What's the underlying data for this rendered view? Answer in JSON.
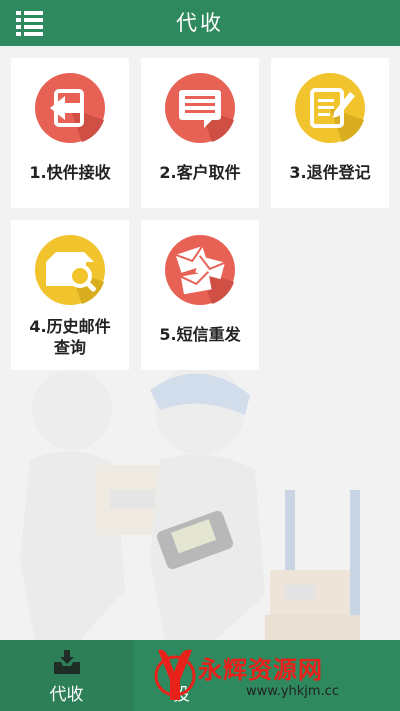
{
  "header": {
    "title": "代收",
    "menu_icon": "list-menu-icon"
  },
  "tiles": [
    {
      "label": "1.快件接收",
      "icon": "arrow-left-icon",
      "color": "#e86155"
    },
    {
      "label": "2.客户取件",
      "icon": "message-icon",
      "color": "#e86155"
    },
    {
      "label": "3.退件登记",
      "icon": "edit-icon",
      "color": "#f1c42e"
    },
    {
      "label": "4.历史邮件查询",
      "label_line1": "4.历史邮件",
      "label_line2": "查询",
      "icon": "box-search-icon",
      "color": "#f1c42e"
    },
    {
      "label": "5.短信重发",
      "icon": "envelopes-icon",
      "color": "#e86155"
    }
  ],
  "tabbar": {
    "active_tab": {
      "label": "代收",
      "icon": "inbox-download-icon"
    },
    "partial_tab_text": "投"
  },
  "watermark": {
    "text": "永辉资源网",
    "url": "www.yhkjm.cc",
    "logo": "yh-logo-icon"
  },
  "colors": {
    "primary": "#2e8a5e",
    "red_icon": "#e86155",
    "yellow_icon": "#f1c42e"
  }
}
